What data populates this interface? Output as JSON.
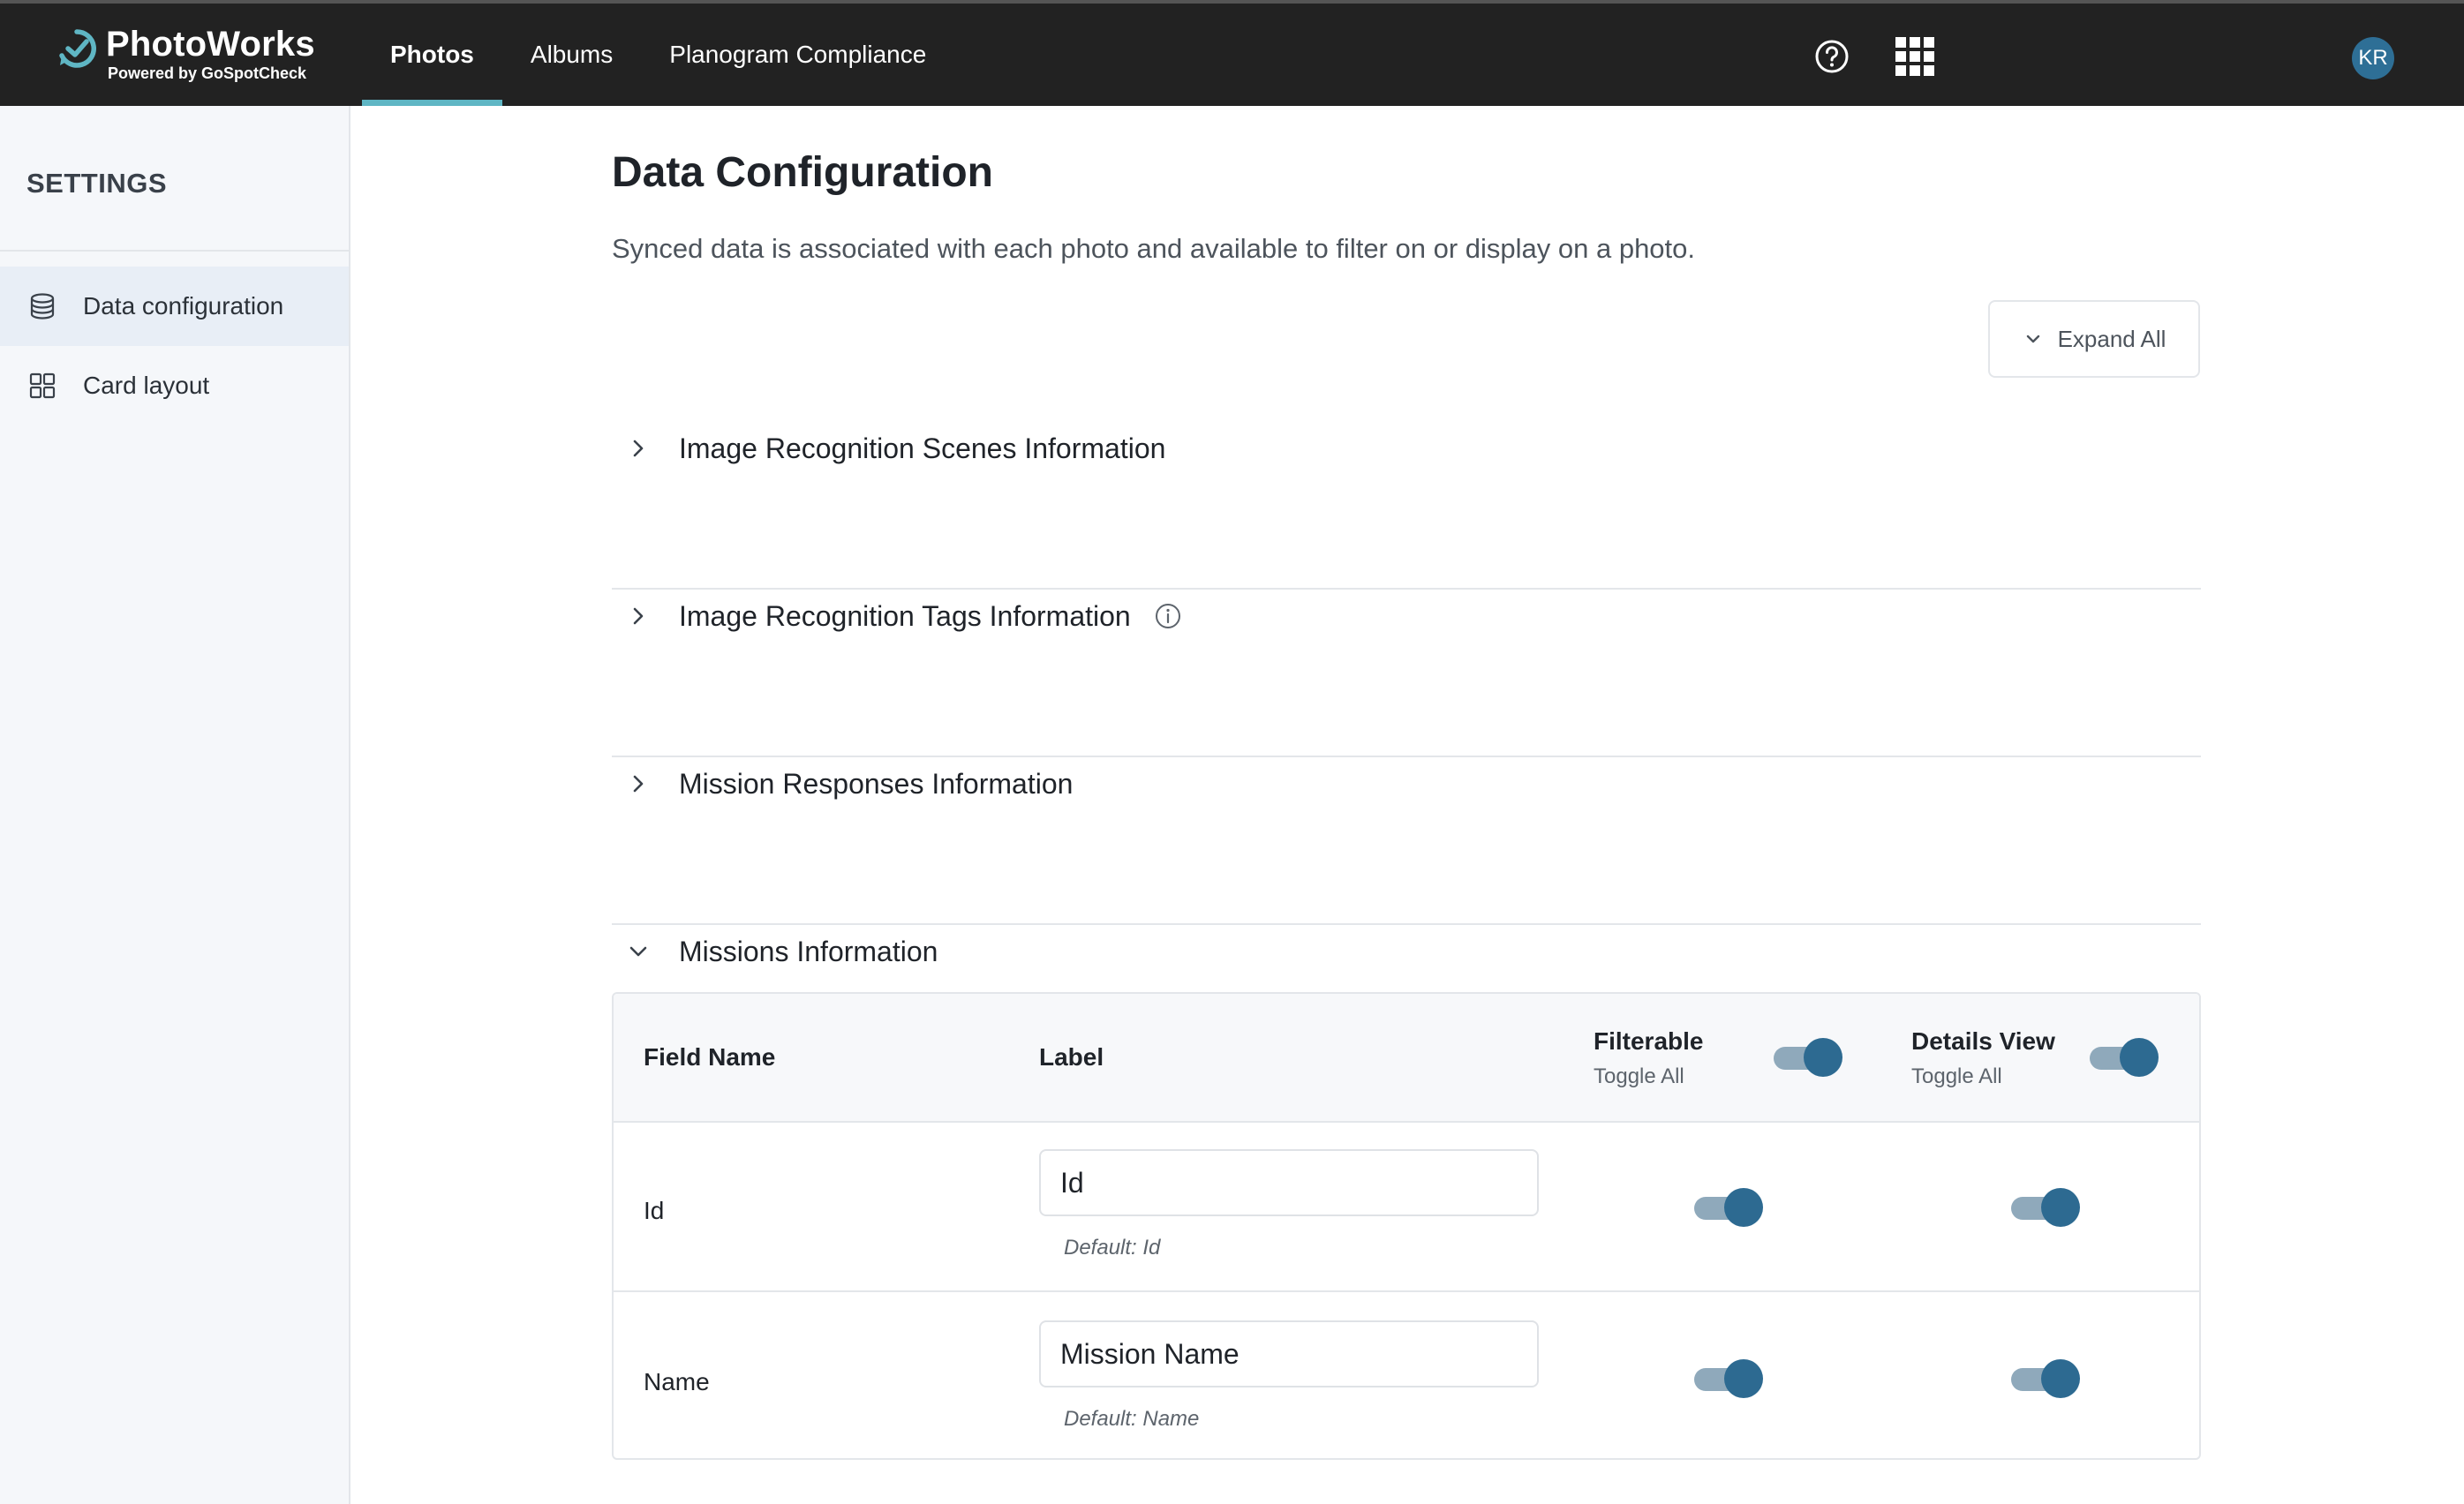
{
  "app": {
    "name": "PhotoWorks",
    "tagline": "Powered by GoSpotCheck",
    "avatar_initials": "KR",
    "accent_color": "#5fb6c4",
    "toggle_color": "#2d6a91"
  },
  "nav": {
    "tabs": [
      {
        "label": "Photos",
        "active": true
      },
      {
        "label": "Albums",
        "active": false
      },
      {
        "label": "Planogram Compliance",
        "active": false
      }
    ],
    "icons": [
      "help-icon",
      "apps-grid-icon"
    ]
  },
  "sidebar": {
    "title": "SETTINGS",
    "items": [
      {
        "label": "Data configuration",
        "icon": "database-icon",
        "active": true
      },
      {
        "label": "Card layout",
        "icon": "grid-layout-icon",
        "active": false
      }
    ]
  },
  "page": {
    "title": "Data Configuration",
    "description": "Synced data is associated with each photo and available to filter on or display on a photo.",
    "expand_all_label": "Expand All"
  },
  "sections": [
    {
      "title": "Image Recognition Scenes Information",
      "expanded": false
    },
    {
      "title": "Image Recognition Tags Information",
      "expanded": false,
      "has_info": true
    },
    {
      "title": "Mission Responses Information",
      "expanded": false
    },
    {
      "title": "Missions Information",
      "expanded": true
    }
  ],
  "table": {
    "headers": {
      "field_name": "Field Name",
      "label": "Label",
      "filterable": "Filterable",
      "filterable_sub": "Toggle All",
      "details_view": "Details View",
      "details_view_sub": "Toggle All"
    },
    "toggle_all": {
      "filterable": true,
      "details_view": true
    },
    "rows": [
      {
        "field": "Id",
        "label_value": "Id",
        "default": "Default: Id",
        "filterable": true,
        "details_view": true
      },
      {
        "field": "Name",
        "label_value": "Mission Name",
        "default": "Default: Name",
        "filterable": true,
        "details_view": true
      }
    ]
  }
}
